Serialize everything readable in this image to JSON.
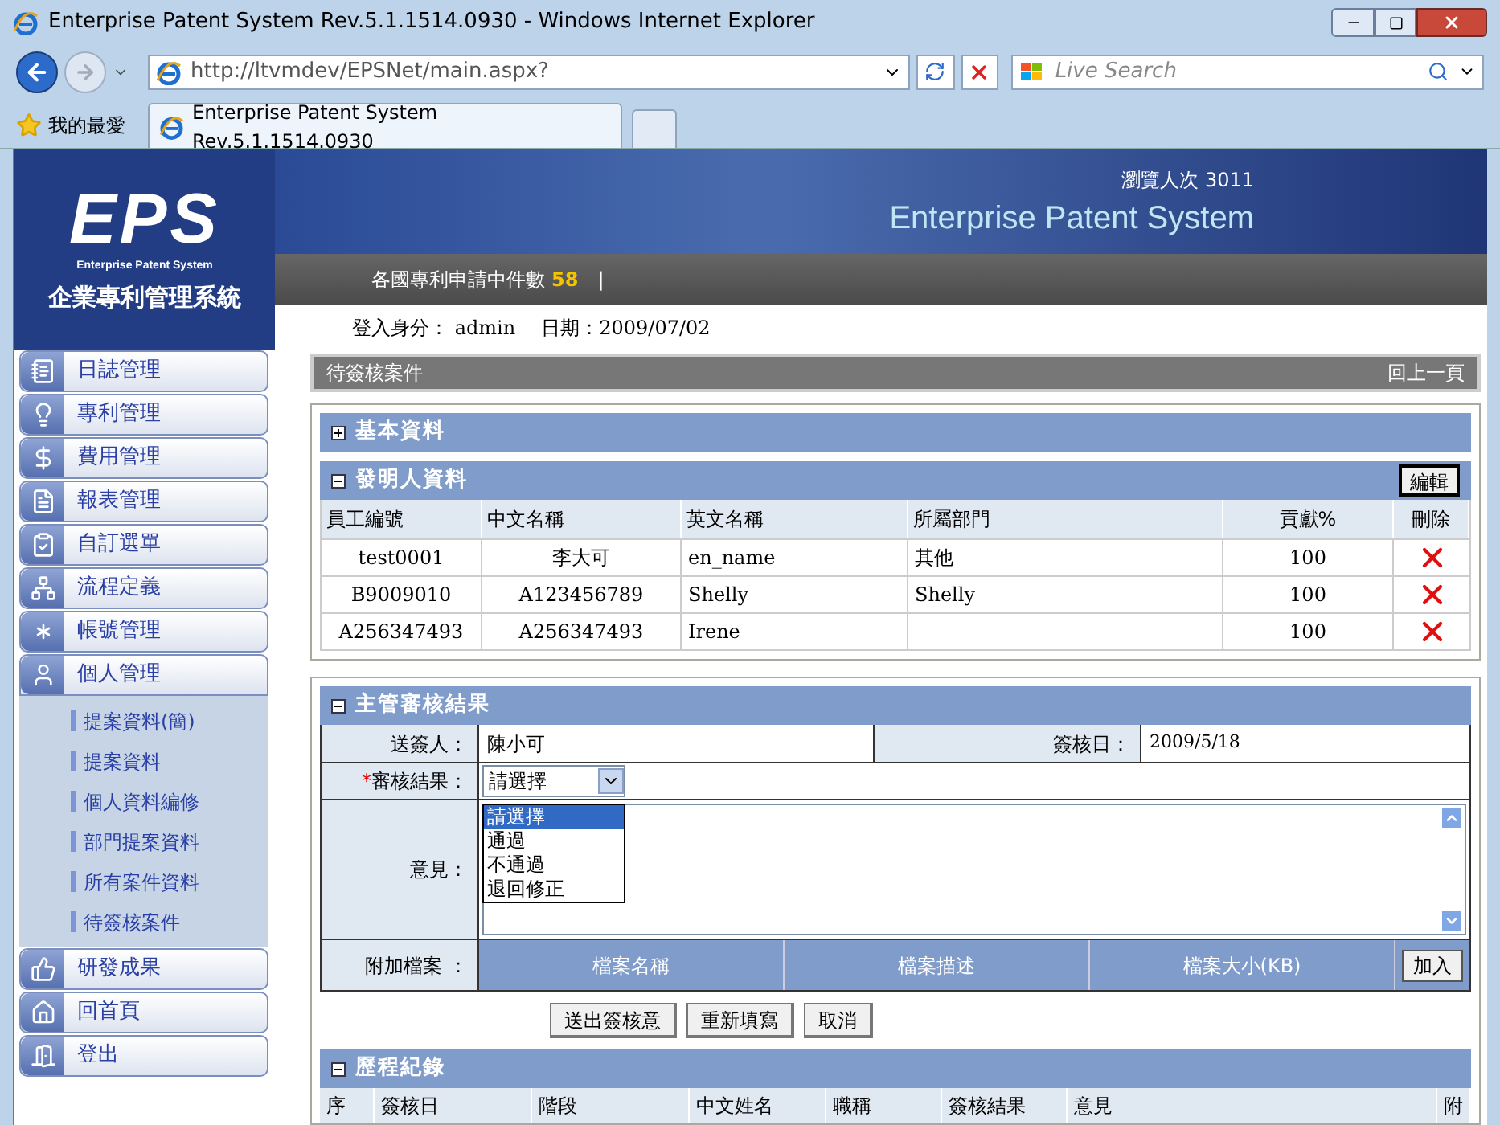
{
  "browser": {
    "title": "Enterprise Patent System Rev.5.1.1514.0930 - Windows Internet Explorer",
    "address": "http://ltvmdev/EPSNet/main.aspx?",
    "search_placeholder": "Live Search",
    "favorites": "我的最愛",
    "tab": "Enterprise Patent System Rev.5.1.1514.0930"
  },
  "header": {
    "logo_letters": "EPS",
    "logo_subtitle": "Enterprise Patent System",
    "logo_name": "企業專利管理系統",
    "visits": "瀏覽人次 3011",
    "system_name": "Enterprise Patent System",
    "pending_label": "各國專利申請中件數",
    "pending_count": "58",
    "separator": "|",
    "login": "登入身分： admin",
    "date": "日期：2009/07/02"
  },
  "sidebar": {
    "items": [
      {
        "label": "日誌管理",
        "expanded": false
      },
      {
        "label": "專利管理",
        "expanded": false
      },
      {
        "label": "費用管理",
        "expanded": false
      },
      {
        "label": "報表管理",
        "expanded": false
      },
      {
        "label": "自訂選單",
        "expanded": false
      },
      {
        "label": "流程定義",
        "expanded": false
      },
      {
        "label": "帳號管理",
        "expanded": false
      },
      {
        "label": "個人管理",
        "expanded": true,
        "children": [
          {
            "label": "提案資料(簡)"
          },
          {
            "label": "提案資料"
          },
          {
            "label": "個人資料編修"
          },
          {
            "label": "部門提案資料"
          },
          {
            "label": "所有案件資料"
          },
          {
            "label": "待簽核案件"
          }
        ]
      },
      {
        "label": "研發成果",
        "expanded": false
      },
      {
        "label": "回首頁",
        "expanded": false
      },
      {
        "label": "登出",
        "expanded": false
      }
    ]
  },
  "page": {
    "title": "待簽核案件",
    "back": "回上一頁"
  },
  "basic_section": {
    "title": "基本資料",
    "expanded": false
  },
  "inventor_section": {
    "title": "發明人資料",
    "expanded": true,
    "edit_button": "編輯",
    "columns": [
      "員工編號",
      "中文名稱",
      "英文名稱",
      "所屬部門",
      "貢獻%",
      "刪除"
    ],
    "rows": [
      {
        "id": "test0001",
        "zh_name": "李大可",
        "en_name": "en_name",
        "dept": "其他",
        "share": "100"
      },
      {
        "id": "B9009010",
        "zh_name": "A123456789",
        "en_name": "Shelly",
        "dept": "Shelly",
        "share": "100"
      },
      {
        "id": "A256347493",
        "zh_name": "A256347493",
        "en_name": "Irene",
        "dept": "",
        "share": "100"
      }
    ]
  },
  "review_section": {
    "title": "主管審核結果",
    "expanded": true,
    "sender_label": "送簽人：",
    "sender": "陳小可",
    "date_label": "簽核日：",
    "date": "2009/5/18",
    "required_mark": "*",
    "result_label": "審核結果：",
    "result_value": "請選擇",
    "options": [
      {
        "label": "請選擇",
        "selected": true
      },
      {
        "label": "通過",
        "selected": false
      },
      {
        "label": "不通過",
        "selected": false
      },
      {
        "label": "退回修正",
        "selected": false
      }
    ],
    "opinion_label": "意見：",
    "attachment_label": "附加檔案 ：",
    "attachment_columns": [
      "檔案名稱",
      "檔案描述",
      "檔案大小(KB)"
    ],
    "add_button": "加入"
  },
  "actions": [
    "送出簽核意",
    "重新填寫",
    "取消"
  ],
  "history_section": {
    "title": "歷程紀錄",
    "expanded": true,
    "columns": [
      "序",
      "簽核日",
      "階段",
      "中文姓名",
      "職稱",
      "簽核結果",
      "意見",
      "附"
    ]
  }
}
